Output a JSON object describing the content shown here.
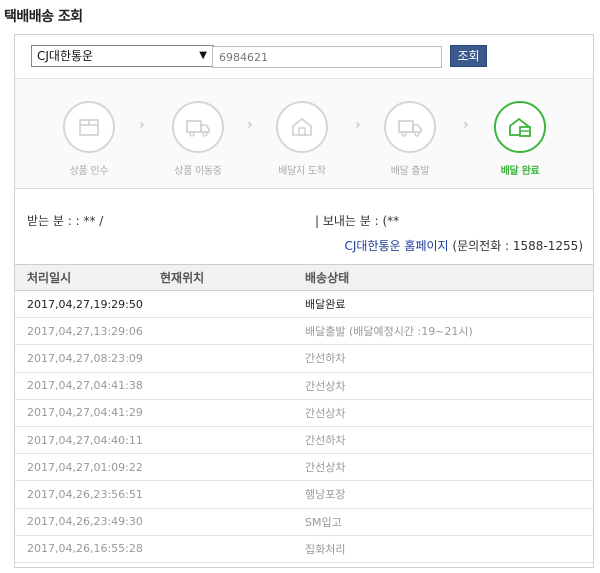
{
  "page": {
    "title": "택배배송 조회"
  },
  "search": {
    "carrier": "CJ대한통운",
    "tracking_number": "6984621",
    "button_label": "조회"
  },
  "steps": [
    {
      "label": "상품 인수",
      "icon": "box-icon",
      "active": false
    },
    {
      "label": "상품 이동중",
      "icon": "truck-icon",
      "active": false
    },
    {
      "label": "배달지 도착",
      "icon": "house-icon",
      "active": false
    },
    {
      "label": "배달 출발",
      "icon": "delivery-truck-icon",
      "active": false
    },
    {
      "label": "배달 완료",
      "icon": "house-package-icon",
      "active": true
    }
  ],
  "info": {
    "receiver": "받는 분 : : ** /",
    "sender": "| 보내는 분 : (**",
    "carrier_link": "CJ대한통운 홈페이지",
    "contact": " (문의전화 : 1588-1255)"
  },
  "table": {
    "headers": {
      "date": "처리일시",
      "location": "현재위치",
      "status": "배송상태"
    },
    "rows": [
      {
        "date": "2017,04,27,19:29:50",
        "location": "",
        "status": "배달완료"
      },
      {
        "date": "2017,04,27,13:29:06",
        "location": "",
        "status": "배달출발 (배달예정시간 :19~21시)"
      },
      {
        "date": "2017,04,27,08:23:09",
        "location": "",
        "status": "간선하차"
      },
      {
        "date": "2017,04,27,04:41:38",
        "location": "",
        "status": "간선상차"
      },
      {
        "date": "2017,04,27,04:41:29",
        "location": "",
        "status": "간선상차"
      },
      {
        "date": "2017,04,27,04:40:11",
        "location": "",
        "status": "간선하차"
      },
      {
        "date": "2017,04,27,01:09:22",
        "location": "",
        "status": "간선상차"
      },
      {
        "date": "2017,04,26,23:56:51",
        "location": "",
        "status": "행낭포장"
      },
      {
        "date": "2017,04,26,23:49:30",
        "location": "",
        "status": "SM입고"
      },
      {
        "date": "2017,04,26,16:55:28",
        "location": "",
        "status": "집화처리"
      }
    ]
  },
  "colors": {
    "active_step": "#3cb53c",
    "inactive_step": "#d6d6d6",
    "button": "#3a5a8e",
    "link": "#1c3e99"
  }
}
